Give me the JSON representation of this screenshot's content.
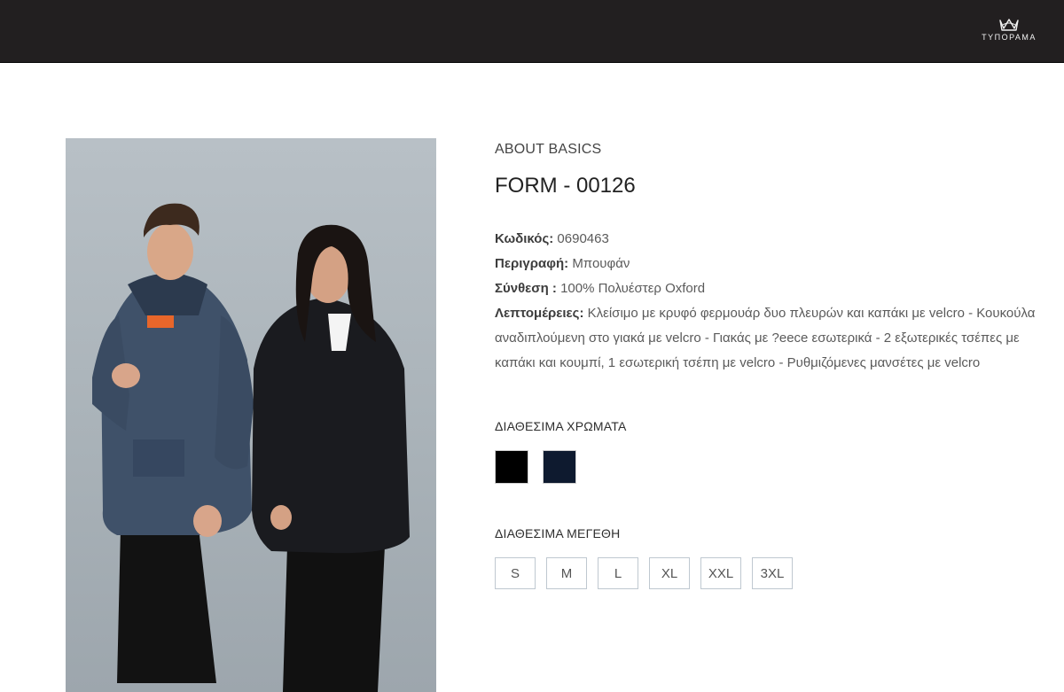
{
  "header": {
    "logo_text": "ΤΥΠΟΡΑΜΑ",
    "background": "#221f20"
  },
  "product": {
    "brand": "ABOUT BASICS",
    "title": "FORM - 00126",
    "image_icon": "product-photo",
    "specs": [
      {
        "label": "Κωδικός:",
        "value": "0690463"
      },
      {
        "label": "Περιγραφή:",
        "value": "Μπουφάν"
      },
      {
        "label": "Σύνθεση :",
        "value": "100% Πολυέστερ Oxford"
      },
      {
        "label": "Λεπτομέρειες:",
        "value": "Κλείσιμο με κρυφό φερμουάρ δυο πλευρών και καπάκι με velcro - Κουκούλα αναδιπλούμενη στο γιακά με velcro - Γιακάς με ?eece  εσωτερικά - 2 εξωτερικές τσέπες με καπάκι και κουμπί, 1 εσωτερική τσέπη με velcro - Ρυθμιζόμενες μανσέτες με velcro"
      }
    ]
  },
  "colors": {
    "heading": "ΔΙΑΘΕΣΙΜΑ ΧΡΩΜΑΤΑ",
    "swatches": [
      {
        "name": "black",
        "hex": "#000000"
      },
      {
        "name": "navy",
        "hex": "#0e1a2f"
      }
    ]
  },
  "sizes": {
    "heading": "ΔΙΑΘΕΣΙΜΑ ΜΕΓΕΘΗ",
    "options": [
      "S",
      "M",
      "L",
      "XL",
      "XXL",
      "3XL"
    ]
  }
}
